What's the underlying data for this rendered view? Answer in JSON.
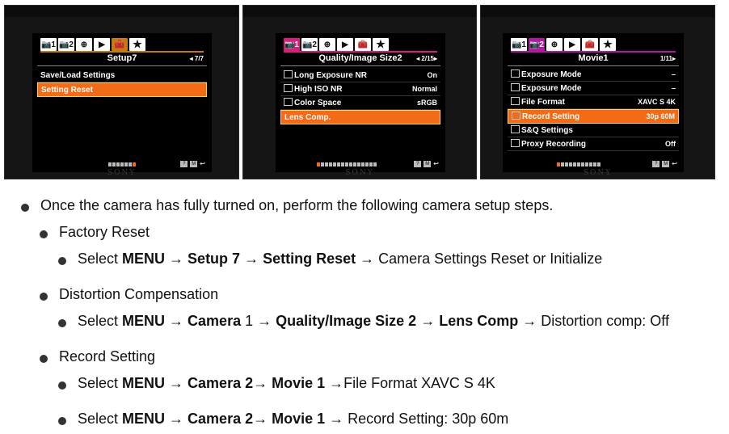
{
  "photos": [
    {
      "brand": "SONY",
      "title": "Setup7",
      "page": "◂ 7/7",
      "tabs": [
        "📷1",
        "📷2",
        "⊕",
        "▶",
        "🧰",
        "★"
      ],
      "rows": [
        {
          "label": "Save/Load Settings",
          "value": ""
        },
        {
          "label": "Setting Reset",
          "value": "",
          "selected": true
        }
      ]
    },
    {
      "brand": "SONY",
      "title": "Quality/Image Size2",
      "page": "◂ 2/15▸",
      "tabs": [
        "📷1",
        "📷2",
        "⊕",
        "▶",
        "🧰",
        "★"
      ],
      "rows": [
        {
          "label": "Long Exposure NR",
          "value": "On"
        },
        {
          "label": "High ISO NR",
          "value": "Normal"
        },
        {
          "label": "Color Space",
          "value": "sRGB"
        },
        {
          "label": "Lens Comp.",
          "value": "",
          "selected": true
        }
      ]
    },
    {
      "brand": "SONY",
      "title": "Movie1",
      "page": "1/11▸",
      "tabs": [
        "📷1",
        "📷2",
        "⊕",
        "▶",
        "🧰",
        "★"
      ],
      "rows": [
        {
          "label": "Exposure Mode",
          "value": "–"
        },
        {
          "label": "Exposure Mode",
          "value": "–"
        },
        {
          "label": "File Format",
          "value": "XAVC S 4K"
        },
        {
          "label": "Record Setting",
          "value": "30p 60M",
          "selected": true
        },
        {
          "label": "S&Q Settings",
          "value": ""
        },
        {
          "label": "Proxy Recording",
          "value": "Off"
        }
      ]
    }
  ],
  "intro": "Once the camera has fully turned on, perform the following camera setup steps.",
  "sections": [
    {
      "heading": "Factory Reset",
      "steps": [
        {
          "parts": [
            {
              "t": "Select ",
              "b": false
            },
            {
              "t": "MENU",
              "b": true
            },
            {
              "t": " → ",
              "b": false
            },
            {
              "t": "Setup 7",
              "b": true
            },
            {
              "t": " → ",
              "b": false
            },
            {
              "t": "Setting Reset",
              "b": true
            },
            {
              "t": " → Camera Settings Reset or Initialize",
              "b": false
            }
          ]
        }
      ]
    },
    {
      "heading": "Distortion Compensation",
      "steps": [
        {
          "parts": [
            {
              "t": "Select ",
              "b": false
            },
            {
              "t": "MENU",
              "b": true
            },
            {
              "t": " → ",
              "b": false
            },
            {
              "t": "Camera",
              "b": true
            },
            {
              "t": " 1 → ",
              "b": false
            },
            {
              "t": "Quality/Image Size 2",
              "b": true
            },
            {
              "t": " → ",
              "b": false
            },
            {
              "t": "Lens Comp",
              "b": true
            },
            {
              "t": " → Distortion comp: Off",
              "b": false
            }
          ]
        }
      ]
    },
    {
      "heading": "Record Setting",
      "steps": [
        {
          "parts": [
            {
              "t": "Select ",
              "b": false
            },
            {
              "t": "MENU",
              "b": true
            },
            {
              "t": " → ",
              "b": false
            },
            {
              "t": "Camera 2",
              "b": true
            },
            {
              "t": "→ ",
              "b": false
            },
            {
              "t": "Movie 1",
              "b": true
            },
            {
              "t": " →File Format XAVC S 4K",
              "b": false
            }
          ]
        },
        {
          "parts": [
            {
              "t": "Select ",
              "b": false
            },
            {
              "t": "MENU",
              "b": true
            },
            {
              "t": " → ",
              "b": false
            },
            {
              "t": "Camera 2",
              "b": true
            },
            {
              "t": "→ ",
              "b": false
            },
            {
              "t": "Movie 1",
              "b": true
            },
            {
              "t": " → Record Setting: 30p 60m",
              "b": false
            }
          ]
        }
      ]
    }
  ]
}
